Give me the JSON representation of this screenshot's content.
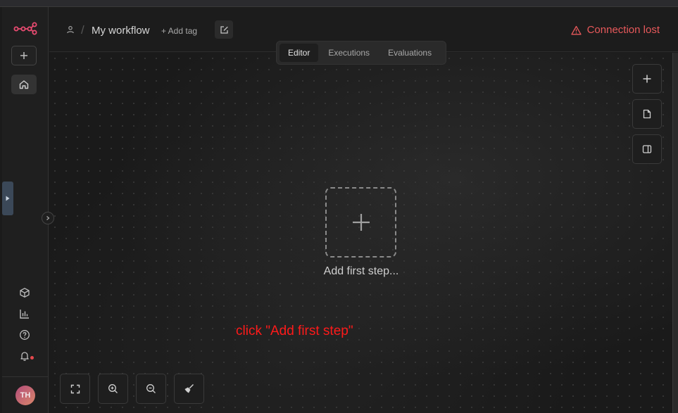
{
  "header": {
    "workflow_name": "My workflow",
    "add_tag_label": "+ Add tag",
    "connection_status": "Connection lost"
  },
  "tabs": [
    {
      "label": "Editor",
      "active": true
    },
    {
      "label": "Executions",
      "active": false
    },
    {
      "label": "Evaluations",
      "active": false
    }
  ],
  "canvas": {
    "add_first_step_label": "Add first step..."
  },
  "annotation": {
    "text": "click \"Add first step\""
  },
  "user": {
    "initials": "TH"
  },
  "colors": {
    "brand": "#ea4b71",
    "error": "#e8595b",
    "annotation": "#ff1a1a"
  },
  "icons": {
    "logo": "n8n-logo-icon",
    "add": "plus-icon",
    "home": "home-icon",
    "templates": "cube-icon",
    "insights": "bar-chart-icon",
    "help": "help-circle-icon",
    "notifications": "bell-icon",
    "fit": "fit-view-icon",
    "zoom_in": "zoom-in-icon",
    "zoom_out": "zoom-out-icon",
    "tidy": "broom-icon",
    "sticky": "note-icon",
    "panel": "panel-icon"
  }
}
